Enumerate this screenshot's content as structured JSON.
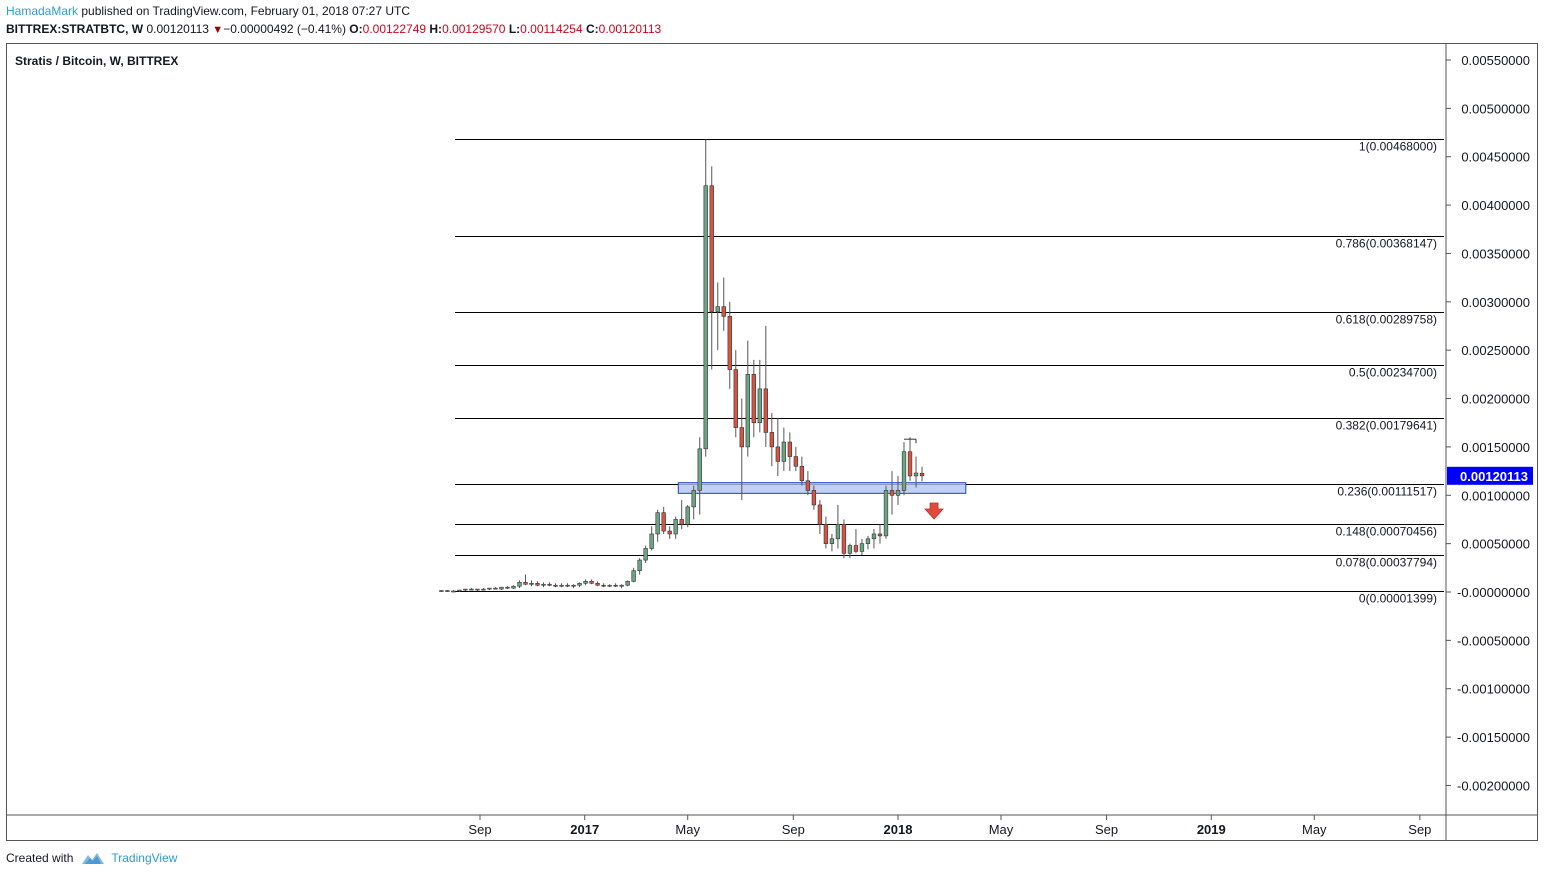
{
  "header": {
    "author": "HamadaMark",
    "published_text": " published on TradingView.com, February 01, 2018 07:27 UTC",
    "symbol_line": "BITTREX:STRATBTC, W",
    "last": "0.00120113",
    "change": "−0.00000492 (−0.41%)",
    "o_label": "O:",
    "o_value": "0.00122749",
    "h_label": "H:",
    "h_value": "0.00129570",
    "l_label": "L:",
    "l_value": "0.00114254",
    "c_label": "C:",
    "c_value": "0.00120113"
  },
  "footer": {
    "created_with": "Created with",
    "brand": "TradingView"
  },
  "colors": {
    "up": "#6ba583",
    "down": "#d75442",
    "axis_badge": "#0000ff",
    "zone_fill": "#b3c6f0",
    "zone_border": "#1e3fd0",
    "arrow": "#e04b3a"
  },
  "chart_data": {
    "type": "candlestick",
    "title": "Stratis / Bitcoin, W, BITTREX",
    "current_price_label": "0.00120113",
    "y_ticks": [
      "0.00550000",
      "0.00500000",
      "0.00450000",
      "0.00400000",
      "0.00350000",
      "0.00300000",
      "0.00250000",
      "0.00200000",
      "0.00150000",
      "0.00100000",
      "0.00050000",
      "-0.00000000",
      "-0.00050000",
      "-0.00100000",
      "-0.00150000",
      "-0.00200000"
    ],
    "y_tick_values": [
      0.0055,
      0.005,
      0.0045,
      0.004,
      0.0035,
      0.003,
      0.0025,
      0.002,
      0.0015,
      0.001,
      0.0005,
      0,
      -0.0005,
      -0.001,
      -0.0015,
      -0.002
    ],
    "x_ticks": [
      {
        "label": "Sep",
        "bold": false,
        "date": "2016-09"
      },
      {
        "label": "2017",
        "bold": true,
        "date": "2017-01"
      },
      {
        "label": "May",
        "bold": false,
        "date": "2017-05"
      },
      {
        "label": "Sep",
        "bold": false,
        "date": "2017-09"
      },
      {
        "label": "2018",
        "bold": true,
        "date": "2018-01"
      },
      {
        "label": "May",
        "bold": false,
        "date": "2018-05"
      },
      {
        "label": "Sep",
        "bold": false,
        "date": "2018-09"
      },
      {
        "label": "2019",
        "bold": true,
        "date": "2019-01"
      },
      {
        "label": "May",
        "bold": false,
        "date": "2019-05"
      },
      {
        "label": "Sep",
        "bold": false,
        "date": "2019-09"
      }
    ],
    "fib_levels": [
      {
        "label": "1(0.00468000)",
        "value": 0.00468
      },
      {
        "label": "0.786(0.00368147)",
        "value": 0.00368147
      },
      {
        "label": "0.618(0.00289758)",
        "value": 0.00289758
      },
      {
        "label": "0.5(0.00234700)",
        "value": 0.002347
      },
      {
        "label": "0.382(0.00179641)",
        "value": 0.00179641
      },
      {
        "label": "0.236(0.00111517)",
        "value": 0.00111517
      },
      {
        "label": "0.148(0.00070456)",
        "value": 0.00070456
      },
      {
        "label": "0.078(0.00037794)",
        "value": 0.00037794
      },
      {
        "label": "0(0.00001399)",
        "value": 1.399e-05
      }
    ],
    "support_zone": {
      "low": 0.00102,
      "high": 0.00113
    },
    "candles": [
      {
        "o": 1e-05,
        "h": 2e-05,
        "l": 0.0,
        "c": 1.5e-05
      },
      {
        "o": 1.5e-05,
        "h": 2e-05,
        "l": 0.0,
        "c": 1e-05
      },
      {
        "o": 1e-05,
        "h": 2e-05,
        "l": 0.0,
        "c": 1e-05
      },
      {
        "o": 1e-05,
        "h": 2e-05,
        "l": 0.0,
        "c": 2e-05
      },
      {
        "o": 2e-05,
        "h": 3e-05,
        "l": 1e-05,
        "c": 3e-05
      },
      {
        "o": 3e-05,
        "h": 4e-05,
        "l": 2e-05,
        "c": 2e-05
      },
      {
        "o": 2e-05,
        "h": 3e-05,
        "l": 1e-05,
        "c": 3e-05
      },
      {
        "o": 3e-05,
        "h": 4e-05,
        "l": 2e-05,
        "c": 3e-05
      },
      {
        "o": 3e-05,
        "h": 4e-05,
        "l": 2e-05,
        "c": 4e-05
      },
      {
        "o": 4e-05,
        "h": 5e-05,
        "l": 3e-05,
        "c": 3e-05
      },
      {
        "o": 3e-05,
        "h": 5e-05,
        "l": 2e-05,
        "c": 5e-05
      },
      {
        "o": 5e-05,
        "h": 6e-05,
        "l": 3e-05,
        "c": 4e-05
      },
      {
        "o": 4e-05,
        "h": 7e-05,
        "l": 3e-05,
        "c": 6e-05
      },
      {
        "o": 6e-05,
        "h": 0.00012,
        "l": 4e-05,
        "c": 0.0001
      },
      {
        "o": 0.0001,
        "h": 0.00018,
        "l": 7e-05,
        "c": 8e-05
      },
      {
        "o": 8e-05,
        "h": 0.00012,
        "l": 6e-05,
        "c": 9e-05
      },
      {
        "o": 9e-05,
        "h": 0.00011,
        "l": 6e-05,
        "c": 7e-05
      },
      {
        "o": 7e-05,
        "h": 0.0001,
        "l": 5e-05,
        "c": 8e-05
      },
      {
        "o": 8e-05,
        "h": 0.0001,
        "l": 6e-05,
        "c": 7e-05
      },
      {
        "o": 7e-05,
        "h": 9e-05,
        "l": 5e-05,
        "c": 6e-05
      },
      {
        "o": 6e-05,
        "h": 9e-05,
        "l": 5e-05,
        "c": 7e-05
      },
      {
        "o": 7e-05,
        "h": 9e-05,
        "l": 5e-05,
        "c": 6e-05
      },
      {
        "o": 6e-05,
        "h": 8e-05,
        "l": 4e-05,
        "c": 7e-05
      },
      {
        "o": 7e-05,
        "h": 0.0001,
        "l": 5e-05,
        "c": 9e-05
      },
      {
        "o": 9e-05,
        "h": 0.00013,
        "l": 7e-05,
        "c": 0.00011
      },
      {
        "o": 0.00011,
        "h": 0.00013,
        "l": 8e-05,
        "c": 9e-05
      },
      {
        "o": 9e-05,
        "h": 0.00011,
        "l": 6e-05,
        "c": 7e-05
      },
      {
        "o": 7e-05,
        "h": 9e-05,
        "l": 5e-05,
        "c": 6e-05
      },
      {
        "o": 6e-05,
        "h": 8e-05,
        "l": 5e-05,
        "c": 7e-05
      },
      {
        "o": 7e-05,
        "h": 9e-05,
        "l": 5e-05,
        "c": 6e-05
      },
      {
        "o": 6e-05,
        "h": 8e-05,
        "l": 4e-05,
        "c": 7e-05
      },
      {
        "o": 7e-05,
        "h": 0.00012,
        "l": 6e-05,
        "c": 0.00011
      },
      {
        "o": 0.00011,
        "h": 0.00025,
        "l": 0.0001,
        "c": 0.00022
      },
      {
        "o": 0.00022,
        "h": 0.00035,
        "l": 0.00018,
        "c": 0.00033
      },
      {
        "o": 0.00033,
        "h": 0.00048,
        "l": 0.0003,
        "c": 0.00045
      },
      {
        "o": 0.00045,
        "h": 0.00068,
        "l": 0.00043,
        "c": 0.0006
      },
      {
        "o": 0.0006,
        "h": 0.00085,
        "l": 0.00052,
        "c": 0.00082
      },
      {
        "o": 0.00082,
        "h": 0.00088,
        "l": 0.0006,
        "c": 0.00063
      },
      {
        "o": 0.00063,
        "h": 0.00068,
        "l": 0.00055,
        "c": 0.0006
      },
      {
        "o": 0.0006,
        "h": 0.00078,
        "l": 0.00055,
        "c": 0.00075
      },
      {
        "o": 0.00075,
        "h": 0.00095,
        "l": 0.00065,
        "c": 0.0007
      },
      {
        "o": 0.0007,
        "h": 0.0009,
        "l": 0.00067,
        "c": 0.00088
      },
      {
        "o": 0.00088,
        "h": 0.0011,
        "l": 0.00075,
        "c": 0.00105
      },
      {
        "o": 0.00105,
        "h": 0.0016,
        "l": 0.0008,
        "c": 0.00148
      },
      {
        "o": 0.00148,
        "h": 0.00468,
        "l": 0.0014,
        "c": 0.0042
      },
      {
        "o": 0.0042,
        "h": 0.0044,
        "l": 0.0023,
        "c": 0.0029
      },
      {
        "o": 0.0029,
        "h": 0.0032,
        "l": 0.0025,
        "c": 0.00295
      },
      {
        "o": 0.00295,
        "h": 0.00325,
        "l": 0.0027,
        "c": 0.00285
      },
      {
        "o": 0.00285,
        "h": 0.003,
        "l": 0.0021,
        "c": 0.0023
      },
      {
        "o": 0.0023,
        "h": 0.0025,
        "l": 0.0016,
        "c": 0.0017
      },
      {
        "o": 0.0017,
        "h": 0.002,
        "l": 0.00095,
        "c": 0.0015
      },
      {
        "o": 0.0015,
        "h": 0.0026,
        "l": 0.0014,
        "c": 0.00225
      },
      {
        "o": 0.00225,
        "h": 0.0024,
        "l": 0.0016,
        "c": 0.00175
      },
      {
        "o": 0.00175,
        "h": 0.0024,
        "l": 0.00165,
        "c": 0.0021
      },
      {
        "o": 0.0021,
        "h": 0.00275,
        "l": 0.0015,
        "c": 0.00165
      },
      {
        "o": 0.00165,
        "h": 0.00185,
        "l": 0.0013,
        "c": 0.0015
      },
      {
        "o": 0.0015,
        "h": 0.0018,
        "l": 0.0012,
        "c": 0.00135
      },
      {
        "o": 0.00135,
        "h": 0.0017,
        "l": 0.00125,
        "c": 0.00155
      },
      {
        "o": 0.00155,
        "h": 0.00165,
        "l": 0.00125,
        "c": 0.0014
      },
      {
        "o": 0.0014,
        "h": 0.0015,
        "l": 0.00125,
        "c": 0.0013
      },
      {
        "o": 0.0013,
        "h": 0.0014,
        "l": 0.0011,
        "c": 0.00115
      },
      {
        "o": 0.00115,
        "h": 0.00125,
        "l": 0.001,
        "c": 0.00105
      },
      {
        "o": 0.00105,
        "h": 0.0011,
        "l": 0.00085,
        "c": 0.0009
      },
      {
        "o": 0.0009,
        "h": 0.00095,
        "l": 0.0006,
        "c": 0.0007
      },
      {
        "o": 0.0007,
        "h": 0.00078,
        "l": 0.00045,
        "c": 0.0005
      },
      {
        "o": 0.0005,
        "h": 0.0006,
        "l": 0.00042,
        "c": 0.00055
      },
      {
        "o": 0.00055,
        "h": 0.0009,
        "l": 0.00045,
        "c": 0.0007
      },
      {
        "o": 0.0007,
        "h": 0.00075,
        "l": 0.00035,
        "c": 0.0004
      },
      {
        "o": 0.0004,
        "h": 0.0005,
        "l": 0.00035,
        "c": 0.00048
      },
      {
        "o": 0.00048,
        "h": 0.00065,
        "l": 0.0004,
        "c": 0.00042
      },
      {
        "o": 0.00042,
        "h": 0.00055,
        "l": 0.00038,
        "c": 0.0005
      },
      {
        "o": 0.0005,
        "h": 0.00058,
        "l": 0.00044,
        "c": 0.00055
      },
      {
        "o": 0.00055,
        "h": 0.00065,
        "l": 0.00045,
        "c": 0.0006
      },
      {
        "o": 0.0006,
        "h": 0.0007,
        "l": 0.0005,
        "c": 0.00058
      },
      {
        "o": 0.00058,
        "h": 0.0011,
        "l": 0.00055,
        "c": 0.00105
      },
      {
        "o": 0.00105,
        "h": 0.00125,
        "l": 0.0008,
        "c": 0.001
      },
      {
        "o": 0.001,
        "h": 0.0012,
        "l": 0.0009,
        "c": 0.00105
      },
      {
        "o": 0.00105,
        "h": 0.00155,
        "l": 0.001,
        "c": 0.00145
      },
      {
        "o": 0.00145,
        "h": 0.0016,
        "l": 0.00115,
        "c": 0.0012
      },
      {
        "o": 0.0012,
        "h": 0.0014,
        "l": 0.00108,
        "c": 0.00123
      },
      {
        "o": 0.00122749,
        "h": 0.0012957,
        "l": 0.00114254,
        "c": 0.00120113
      }
    ]
  }
}
